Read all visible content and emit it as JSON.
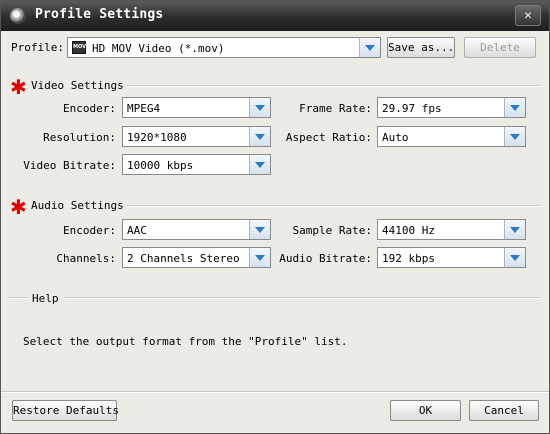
{
  "window": {
    "title": "Profile Settings",
    "close_label": "✕"
  },
  "profile": {
    "label": "Profile:",
    "value": "HD MOV Video (*.mov)",
    "icon_text": "MOV",
    "save_as_label": "Save as...",
    "delete_label": "Delete"
  },
  "video": {
    "title": "Video Settings",
    "encoder_label": "Encoder:",
    "encoder_value": "MPEG4",
    "frame_rate_label": "Frame Rate:",
    "frame_rate_value": "29.97 fps",
    "resolution_label": "Resolution:",
    "resolution_value": "1920*1080",
    "aspect_ratio_label": "Aspect Ratio:",
    "aspect_ratio_value": "Auto",
    "bitrate_label": "Video Bitrate:",
    "bitrate_value": "10000 kbps"
  },
  "audio": {
    "title": "Audio Settings",
    "encoder_label": "Encoder:",
    "encoder_value": "AAC",
    "sample_rate_label": "Sample Rate:",
    "sample_rate_value": "44100 Hz",
    "channels_label": "Channels:",
    "channels_value": "2 Channels Stereo",
    "bitrate_label": "Audio Bitrate:",
    "bitrate_value": "192 kbps"
  },
  "help": {
    "title": "Help",
    "text": "Select the output format from the \"Profile\" list."
  },
  "footer": {
    "restore_label": "Restore Defaults",
    "ok_label": "OK",
    "cancel_label": "Cancel"
  },
  "colors": {
    "accent_arrow": "#2e78c8",
    "star": "#e00000",
    "titlebar": "#2c2c2c"
  }
}
